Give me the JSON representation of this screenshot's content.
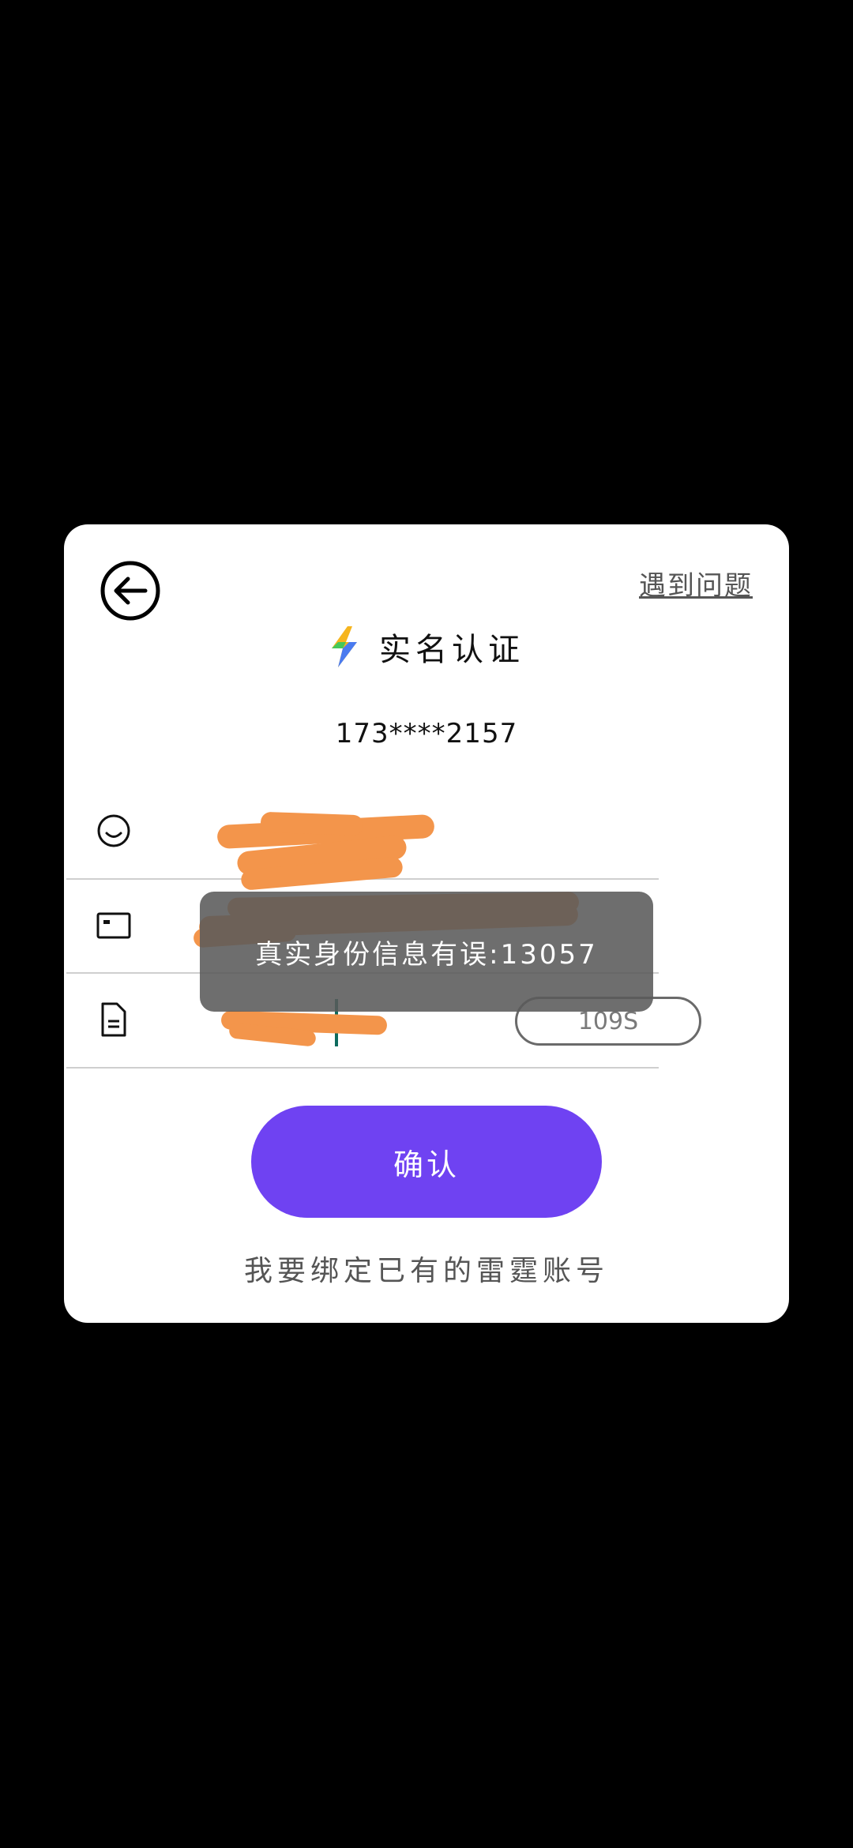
{
  "dialog": {
    "help_link": "遇到问题",
    "title": "实名认证",
    "phone": "173****2157",
    "fields": {
      "name_icon": "smiley-face-icon",
      "id_icon": "id-card-icon",
      "code_icon": "document-icon",
      "countdown": "109S"
    },
    "confirm_label": "确认",
    "bind_account_link": "我要绑定已有的雷霆账号"
  },
  "toast": {
    "message": "真实身份信息有误:13057"
  },
  "colors": {
    "accent": "#6f42f2",
    "redaction": "#f3954b",
    "toast_bg": "#5a5a5a"
  }
}
